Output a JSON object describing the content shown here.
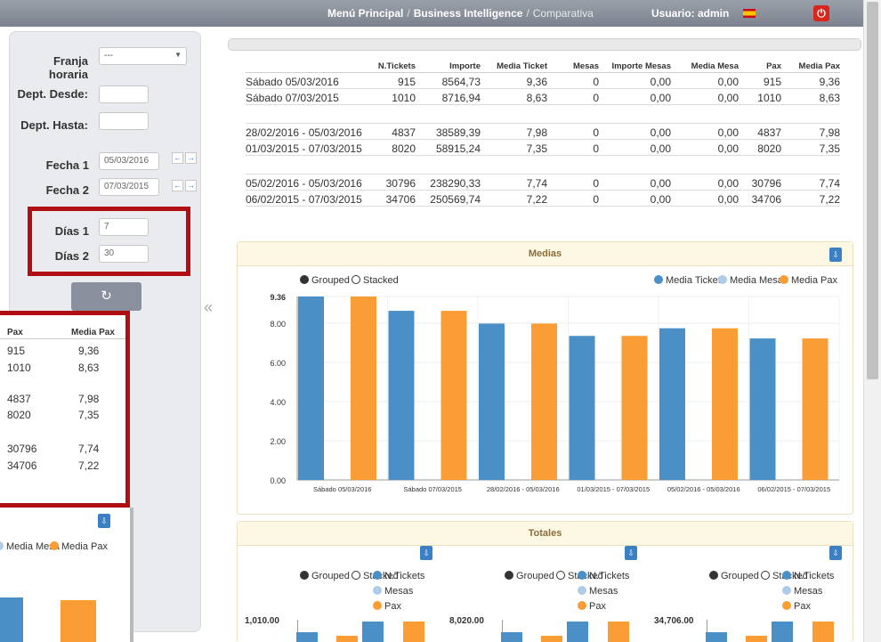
{
  "header": {
    "crumb_home": "Menú Principal",
    "crumb_bi": "Business Intelligence",
    "crumb_current": "Comparativa",
    "separator": "/",
    "user_label": "Usuario: admin"
  },
  "filters": {
    "franja_label": "Franja horaria",
    "franja_value": "---",
    "dept_desde_label": "Dept. Desde:",
    "dept_desde_value": "",
    "dept_hasta_label": "Dept. Hasta:",
    "dept_hasta_value": "",
    "fecha1_label": "Fecha 1",
    "fecha1_value": "05/03/2016",
    "fecha2_label": "Fecha 2",
    "fecha2_value": "07/03/2015",
    "dias1_label": "Días 1",
    "dias1_value": "7",
    "dias2_label": "Días 2",
    "dias2_value": "30"
  },
  "table": {
    "headers": [
      "N.Tickets",
      "Importe",
      "Media Ticket",
      "Mesas",
      "Importe Mesas",
      "Media Mesa",
      "Pax",
      "Media Pax"
    ],
    "rows": [
      [
        "Sábado 05/03/2016",
        "915",
        "8564,73",
        "9,36",
        "0",
        "0,00",
        "0,00",
        "915",
        "9,36"
      ],
      [
        "Sábado 07/03/2015",
        "1010",
        "8716,94",
        "8,63",
        "0",
        "0,00",
        "0,00",
        "1010",
        "8,63"
      ],
      [
        "28/02/2016 - 05/03/2016",
        "4837",
        "38589,39",
        "7,98",
        "0",
        "0,00",
        "0,00",
        "4837",
        "7,98"
      ],
      [
        "01/03/2015 - 07/03/2015",
        "8020",
        "58915,24",
        "7,35",
        "0",
        "0,00",
        "0,00",
        "8020",
        "7,35"
      ],
      [
        "05/02/2016 - 05/03/2016",
        "30796",
        "238290,33",
        "7,74",
        "0",
        "0,00",
        "0,00",
        "30796",
        "7,74"
      ],
      [
        "06/02/2015 - 07/03/2015",
        "34706",
        "250569,74",
        "7,22",
        "0",
        "0,00",
        "0,00",
        "34706",
        "7,22"
      ]
    ]
  },
  "zoom": {
    "headers": [
      "Pax",
      "Media Pax"
    ],
    "rows": [
      [
        "915",
        "9,36"
      ],
      [
        "1010",
        "8,63"
      ],
      [
        "4837",
        "7,98"
      ],
      [
        "8020",
        "7,35"
      ],
      [
        "30796",
        "7,74"
      ],
      [
        "34706",
        "7,22"
      ]
    ],
    "legend_mesa": "Media Mesa",
    "legend_pax": "Media Pax"
  },
  "medias": {
    "title": "Medias",
    "toggle_grouped": "Grouped",
    "toggle_stacked": "Stacked"
  },
  "totales": {
    "title": "Totales",
    "toggle_grouped": "Grouped",
    "toggle_stacked": "Stacked",
    "legend": [
      "N.Tickets",
      "Mesas",
      "Pax"
    ],
    "axis_tops": [
      "1,010.00",
      "8,020.00",
      "34,706.00"
    ]
  },
  "colors": {
    "ticket": "#4a90c7",
    "mesa": "#aecbe8",
    "pax": "#fb9d35"
  },
  "chart_data": {
    "type": "bar",
    "categories": [
      "Sábado 05/03/2016",
      "Sábado 07/03/2015",
      "28/02/2016 - 05/03/2016",
      "01/03/2015 - 07/03/2015",
      "05/02/2016 - 05/03/2016",
      "06/02/2015 - 07/03/2015"
    ],
    "series": [
      {
        "name": "Media Ticket",
        "values": [
          9.36,
          8.63,
          7.98,
          7.35,
          7.74,
          7.22
        ]
      },
      {
        "name": "Media Mesa",
        "values": [
          0,
          0,
          0,
          0,
          0,
          0
        ]
      },
      {
        "name": "Media Pax",
        "values": [
          9.36,
          8.63,
          7.98,
          7.35,
          7.74,
          7.22
        ]
      }
    ],
    "yticks": [
      "0.00",
      "2.00",
      "4.00",
      "6.00",
      "8.00",
      "9.36"
    ],
    "ylim": [
      0,
      9.36
    ],
    "legend": "top-right",
    "grid": true
  }
}
